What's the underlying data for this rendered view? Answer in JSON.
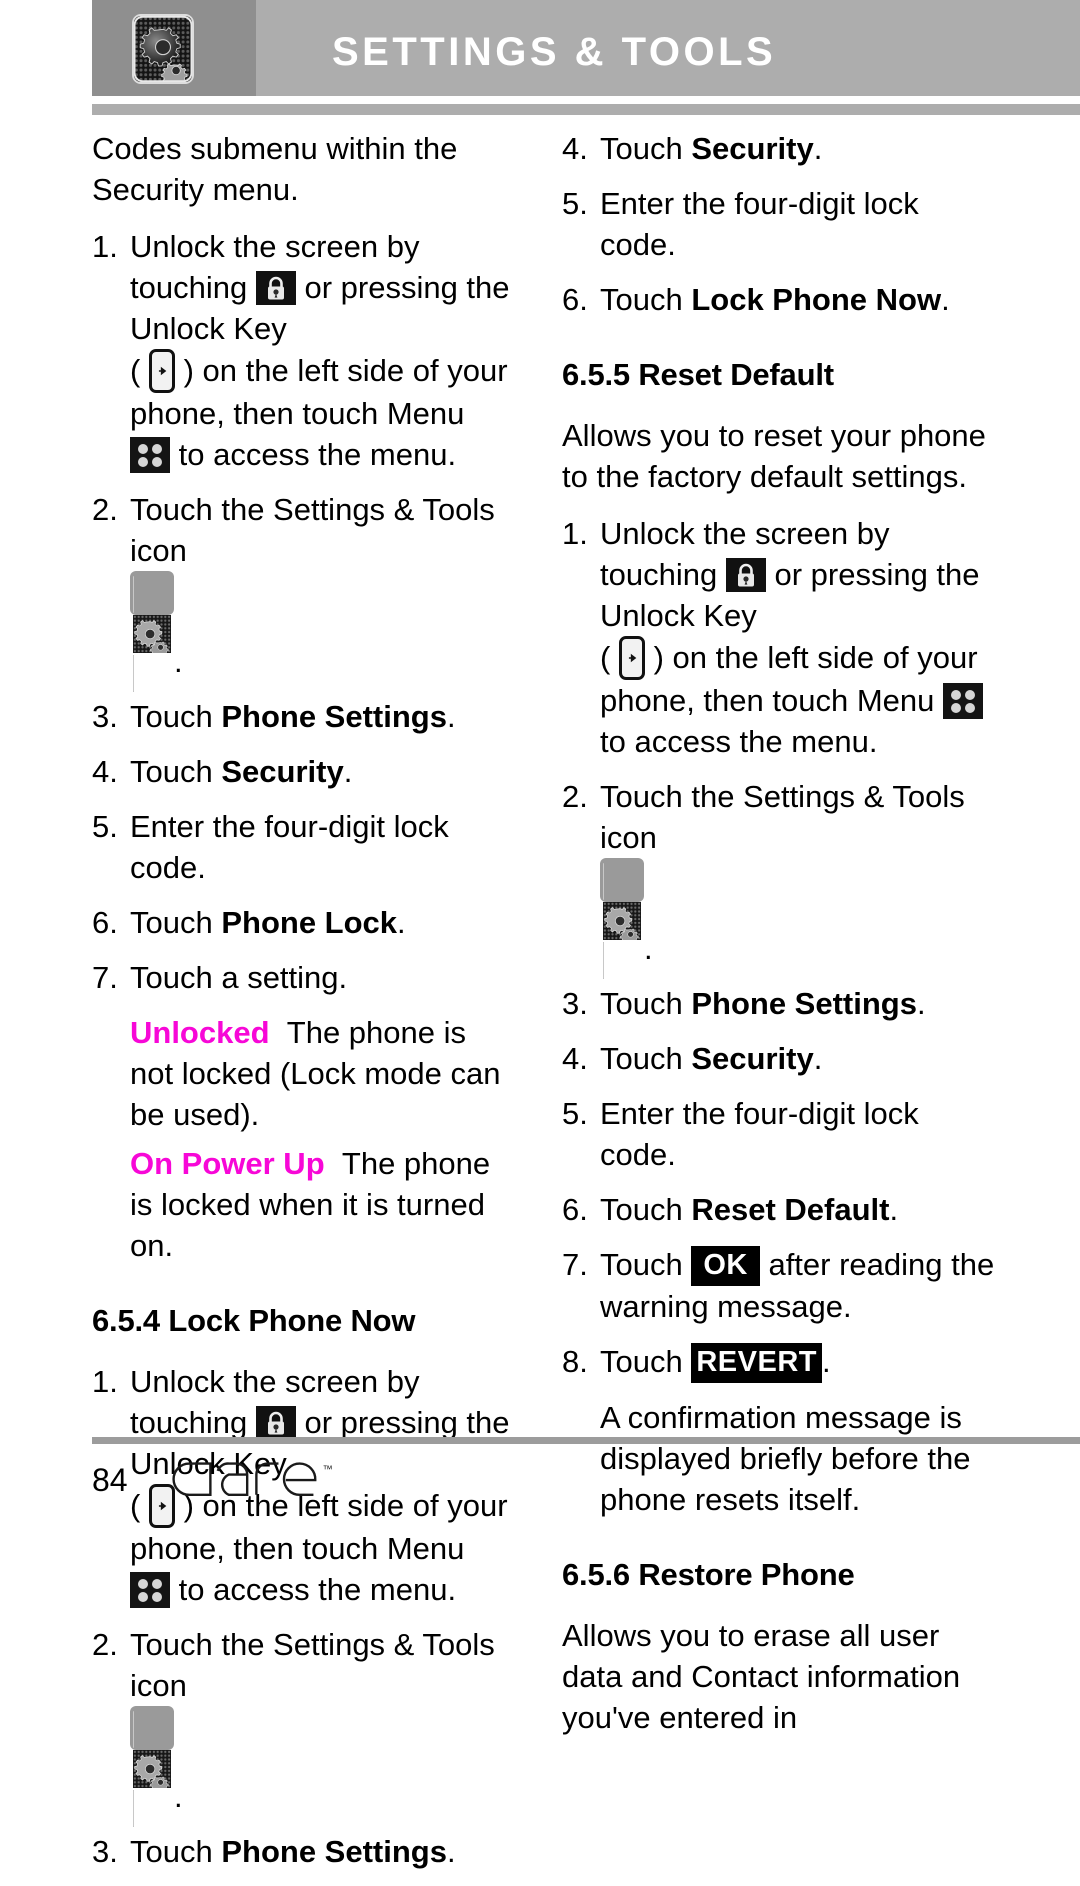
{
  "header": {
    "title": "SETTINGS & TOOLS",
    "icon": "settings-tools-gear-icon",
    "bar_color": "#adadad",
    "icon_box_color": "#8f8f8f"
  },
  "colors": {
    "accent_magenta": "#f707d7",
    "keycap_background": "#000000",
    "keycap_text": "#ffffff"
  },
  "left_column": {
    "intro": "Codes submenu within the Security menu.",
    "steps": [
      {
        "num": "1.",
        "t1": "Unlock the screen by touching",
        "t2": "or pressing the Unlock Key",
        "t3": "(",
        "t4": ") on the left side of your phone, then touch Menu",
        "t5": "to access the menu."
      },
      {
        "num": "2.",
        "t1": "Touch the Settings & Tools icon",
        "t2": "."
      },
      {
        "num": "3.",
        "t1": "Touch ",
        "bold": "Phone Settings",
        "t2": "."
      },
      {
        "num": "4.",
        "t1": "Touch ",
        "bold": "Security",
        "t2": "."
      },
      {
        "num": "5.",
        "t1": "Enter the four-digit lock code."
      },
      {
        "num": "6.",
        "t1": "Touch ",
        "bold": "Phone Lock",
        "t2": "."
      },
      {
        "num": "7.",
        "t1": "Touch a setting."
      }
    ],
    "settings_options": [
      {
        "term": "Unlocked",
        "desc": "The phone is not locked (Lock mode can be used)."
      },
      {
        "term": "On Power Up",
        "desc": "The phone is locked when it is turned on."
      }
    ],
    "section_heading": "6.5.4 Lock Phone Now",
    "steps2": [
      {
        "num": "1.",
        "t1": "Unlock the screen by touching",
        "t2": "or pressing the Unlock Key",
        "t3": "(",
        "t4": ") on the left side of your phone, then touch Menu",
        "t5": "to access the menu."
      },
      {
        "num": "2.",
        "t1": "Touch the Settings & Tools icon",
        "t2": "."
      },
      {
        "num": "3.",
        "t1": "Touch ",
        "bold": "Phone Settings",
        "t2": "."
      }
    ]
  },
  "right_column": {
    "steps_cont": [
      {
        "num": "4.",
        "t1": "Touch ",
        "bold": "Security",
        "t2": "."
      },
      {
        "num": "5.",
        "t1": "Enter the four-digit lock code."
      },
      {
        "num": "6.",
        "t1": "Touch ",
        "bold": "Lock Phone Now",
        "t2": "."
      }
    ],
    "section_heading_1": "6.5.5 Reset Default",
    "section_intro_1": "Allows you to reset your phone to the factory default settings.",
    "steps": [
      {
        "num": "1.",
        "t1": "Unlock the screen by touching",
        "t2": "or pressing the Unlock Key",
        "t3": "(",
        "t4": ") on the left side of your phone, then touch Menu",
        "t5": "to access the menu."
      },
      {
        "num": "2.",
        "t1": "Touch the Settings & Tools icon",
        "t2": "."
      },
      {
        "num": "3.",
        "t1": "Touch ",
        "bold": "Phone Settings",
        "t2": "."
      },
      {
        "num": "4.",
        "t1": "Touch ",
        "bold": "Security",
        "t2": "."
      },
      {
        "num": "5.",
        "t1": "Enter the four-digit lock code."
      },
      {
        "num": "6.",
        "t1": "Touch ",
        "bold": "Reset Default",
        "t2": "."
      },
      {
        "num": "7.",
        "t1": "Touch ",
        "keycap": "OK",
        "t2": " after reading the warning message."
      },
      {
        "num": "8.",
        "t1": "Touch ",
        "keycap": "REVERT",
        "t2": ".",
        "sub": "A confirmation message is displayed briefly before the phone resets itself."
      }
    ],
    "section_heading_2": "6.5.6 Restore Phone",
    "section_intro_2": "Allows you to erase all user data and Contact information you've entered in"
  },
  "footer": {
    "page_number": "84",
    "brand": "dare",
    "trademark": "TM"
  }
}
